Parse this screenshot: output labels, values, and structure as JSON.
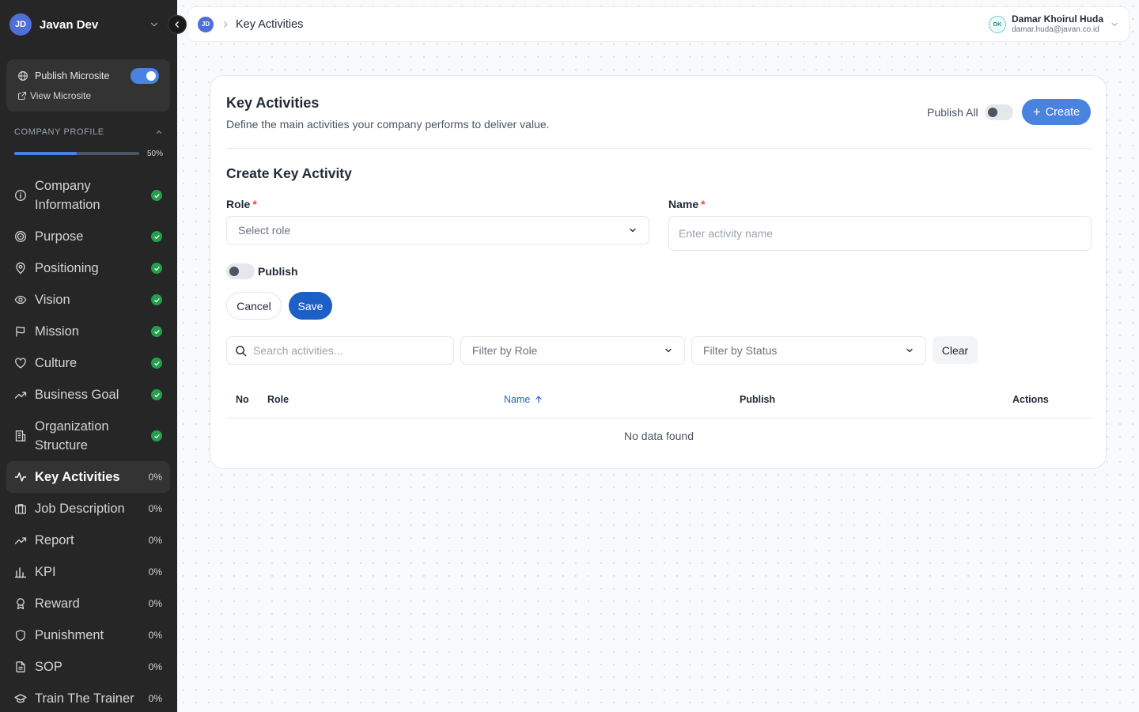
{
  "sidebar": {
    "workspace": {
      "initials": "JD",
      "name": "Javan Dev"
    },
    "publish_microsite_label": "Publish Microsite",
    "publish_microsite_on": true,
    "view_microsite_label": "View Microsite",
    "company_profile": {
      "label": "COMPANY PROFILE",
      "progress_percent": 50,
      "progress_label": "50%"
    },
    "items": [
      {
        "label": "Company Information",
        "status": "complete"
      },
      {
        "label": "Purpose",
        "status": "complete"
      },
      {
        "label": "Positioning",
        "status": "complete"
      },
      {
        "label": "Vision",
        "status": "complete"
      },
      {
        "label": "Mission",
        "status": "complete"
      },
      {
        "label": "Culture",
        "status": "complete"
      },
      {
        "label": "Business Goal",
        "status": "complete"
      },
      {
        "label": "Organization Structure",
        "status": "complete"
      },
      {
        "label": "Key Activities",
        "status": "0%",
        "active": true
      },
      {
        "label": "Job Description",
        "status": "0%"
      },
      {
        "label": "Report",
        "status": "0%"
      },
      {
        "label": "KPI",
        "status": "0%"
      },
      {
        "label": "Reward",
        "status": "0%"
      },
      {
        "label": "Punishment",
        "status": "0%"
      },
      {
        "label": "SOP",
        "status": "0%"
      },
      {
        "label": "Train The Trainer",
        "status": "0%"
      }
    ]
  },
  "topbar": {
    "workspace_initials": "JD",
    "breadcrumb_current": "Key Activities",
    "user": {
      "initials": "DK",
      "name": "Damar Khoirul Huda",
      "email": "damar.huda@javan.co.id"
    }
  },
  "main": {
    "title": "Key Activities",
    "subtitle": "Define the main activities your company performs to deliver value.",
    "publish_all_label": "Publish All",
    "create_label": "Create",
    "form": {
      "title": "Create Key Activity",
      "role_label": "Role",
      "role_placeholder": "Select role",
      "name_label": "Name",
      "name_placeholder": "Enter activity name",
      "required_mark": "*",
      "publish_label": "Publish",
      "cancel_label": "Cancel",
      "save_label": "Save"
    },
    "filters": {
      "search_placeholder": "Search activities...",
      "role_placeholder": "Filter by Role",
      "status_placeholder": "Filter by Status",
      "clear_label": "Clear"
    },
    "table": {
      "columns": [
        "No",
        "Role",
        "Name",
        "Publish",
        "Actions"
      ],
      "sorted_column": "Name",
      "empty_text": "No data found"
    }
  },
  "colors": {
    "sidebar_bg": "#262626",
    "accent": "#4a82e0",
    "primary_button": "#1d5fc4",
    "success": "#22a04b"
  }
}
